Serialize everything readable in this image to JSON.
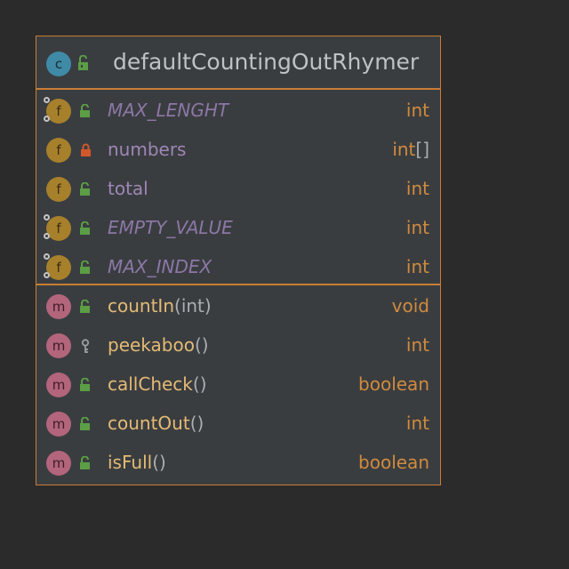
{
  "class": {
    "badge": "c",
    "name": "defaultCountingOutRhymer",
    "visibility": "public"
  },
  "fields": [
    {
      "badge": "f",
      "name": "MAX_LENGHT",
      "type": "int",
      "visibility": "public",
      "static": true
    },
    {
      "badge": "f",
      "name": "numbers",
      "type": "int",
      "type_suffix": "[]",
      "visibility": "private",
      "static": false
    },
    {
      "badge": "f",
      "name": "total",
      "type": "int",
      "visibility": "public",
      "static": false
    },
    {
      "badge": "f",
      "name": "EMPTY_VALUE",
      "type": "int",
      "visibility": "public",
      "static": true
    },
    {
      "badge": "f",
      "name": "MAX_INDEX",
      "type": "int",
      "visibility": "public",
      "static": true
    }
  ],
  "methods": [
    {
      "badge": "m",
      "name": "countIn",
      "param_open": "(",
      "param": "int",
      "param_close": ")",
      "return": "void",
      "visibility": "public"
    },
    {
      "badge": "m",
      "name": "peekaboo",
      "param_open": "()",
      "param": "",
      "param_close": "",
      "return": "int",
      "visibility": "package"
    },
    {
      "badge": "m",
      "name": "callCheck",
      "param_open": "()",
      "param": "",
      "param_close": "",
      "return": "boolean",
      "visibility": "public"
    },
    {
      "badge": "m",
      "name": "countOut",
      "param_open": "()",
      "param": "",
      "param_close": "",
      "return": "int",
      "visibility": "public"
    },
    {
      "badge": "m",
      "name": "isFull",
      "param_open": "()",
      "param": "",
      "param_close": "",
      "return": "boolean",
      "visibility": "public"
    }
  ],
  "colors": {
    "border": "#c87d36",
    "background": "#3a3d40",
    "public_lock": "#5b9e45",
    "private_lock": "#d1582a"
  }
}
